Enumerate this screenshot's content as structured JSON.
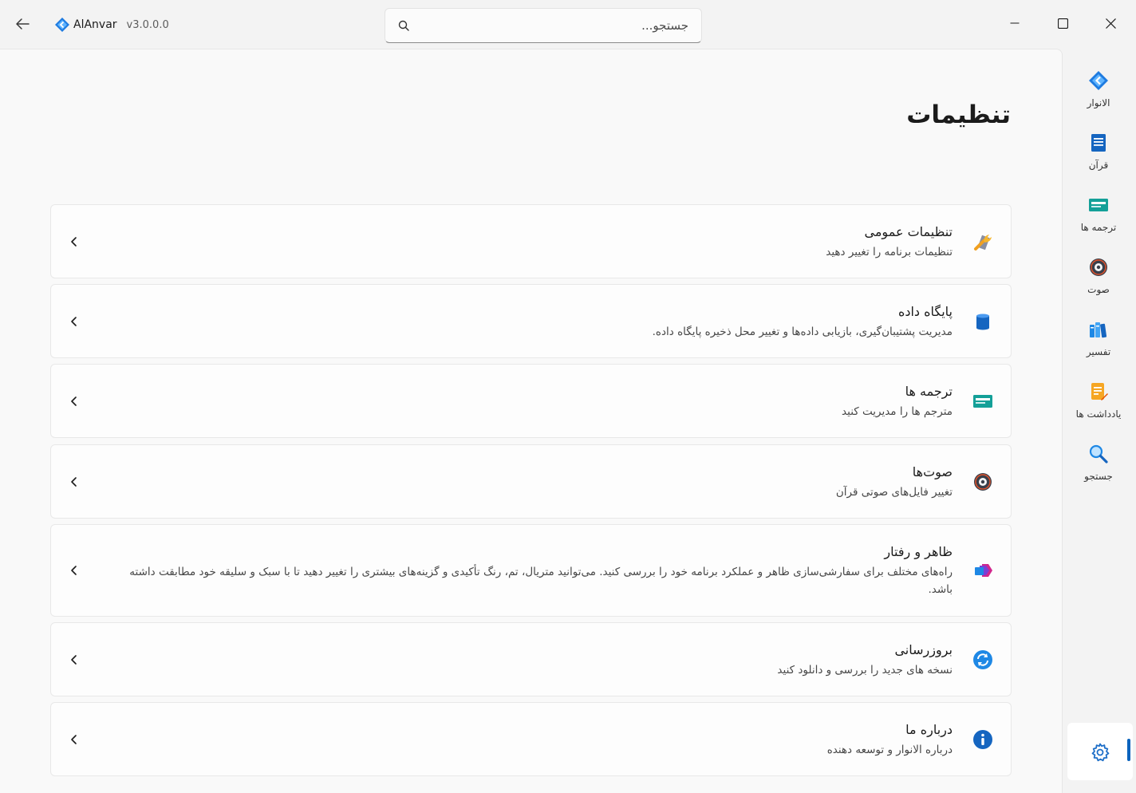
{
  "app": {
    "name": "AlAnvar",
    "version": "v3.0.0.0"
  },
  "search": {
    "placeholder": "جستجو..."
  },
  "page": {
    "title": "تنظیمات"
  },
  "settings_cards": [
    {
      "title": "تنظیمات عمومی",
      "desc": "تنظیمات برنامه را تغییر دهید",
      "icon": "wrench-icon"
    },
    {
      "title": "پایگاه داده",
      "desc": "مدیریت پشتیبان‌گیری، بازیابی داده‌ها و تغییر محل ذخیره پایگاه داده.",
      "icon": "database-icon"
    },
    {
      "title": "ترجمه ها",
      "desc": "مترجم ها را مدیریت کنید",
      "icon": "translation-icon"
    },
    {
      "title": "صوت‌ها",
      "desc": "تغییر فایل‌های صوتی قرآن",
      "icon": "speaker-icon"
    },
    {
      "title": "ظاهر و رفتار",
      "desc": "راه‌های مختلف برای سفارشی‌سازی ظاهر و عملکرد برنامه خود را بررسی کنید. می‌توانید متریال، تم، رنگ تأکیدی و گزینه‌های بیشتری را تغییر دهید تا با سبک و سلیقه خود مطابقت داشته باشد.",
      "icon": "appearance-icon"
    },
    {
      "title": "بروزرسانی",
      "desc": "نسخه های جدید را بررسی و دانلود کنید",
      "icon": "refresh-icon"
    },
    {
      "title": "درباره ما",
      "desc": "درباره الانوار و توسعه دهنده",
      "icon": "info-icon"
    }
  ],
  "nav": [
    {
      "label": "الانوار",
      "icon": "alanvar-logo-icon"
    },
    {
      "label": "قرآن",
      "icon": "quran-icon"
    },
    {
      "label": "ترجمه ها",
      "icon": "translation-icon"
    },
    {
      "label": "صوت",
      "icon": "speaker-icon"
    },
    {
      "label": "تفسیر",
      "icon": "books-icon"
    },
    {
      "label": "یادداشت ها",
      "icon": "notes-icon"
    },
    {
      "label": "جستجو",
      "icon": "magnifier-icon"
    }
  ],
  "nav_selected": {
    "icon": "gear-icon"
  },
  "colors": {
    "accent": "#0a63bd",
    "background": "#f3f3f3",
    "panel": "#f9f9f9"
  }
}
